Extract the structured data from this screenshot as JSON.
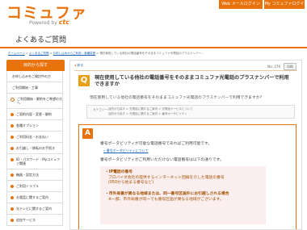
{
  "header": {
    "logo_text": "コミュファ",
    "logo_sub_prefix": "Powered by",
    "logo_sub_brand": "ctc",
    "top_nav": [
      "Web メールログイン",
      "My コミュファログイン"
    ],
    "page_title": "よくあるご質問"
  },
  "breadcrumb": {
    "items": [
      "ホームページ",
      "よくあるご質問",
      "お申し込みからご利用・各種変更",
      "現在使用している他社の電話番号をそのままコミュファ光電話のプラスナンバー..."
    ]
  },
  "sidebar": {
    "heading": "目的から探す",
    "items": [
      {
        "label": "お申し込みをご検討中の方",
        "style": "plain"
      },
      {
        "label": "ご利用開始・工事",
        "style": "plain"
      },
      {
        "label": "ご利用開始・解約をご希望の方へ",
        "style": "sub"
      },
      {
        "label": "ご契約内容・変更・解約",
        "style": "bullet"
      },
      {
        "label": "各種オプション",
        "style": "bullet"
      },
      {
        "label": "ご利用料金・お支払い",
        "style": "bullet"
      },
      {
        "label": "お引越し・移転のお手続き",
        "style": "bullet"
      },
      {
        "label": "ID・パスワード・Myコミュファ関連",
        "style": "bullet"
      },
      {
        "label": "機器・設定方法",
        "style": "bullet"
      },
      {
        "label": "ご利用トラブル",
        "style": "bullet"
      },
      {
        "label": "お電話に関するご案内",
        "style": "bullet"
      },
      {
        "label": "光テレビに関するご案内",
        "style": "bullet"
      },
      {
        "label": "追加サービス",
        "style": "bullet"
      }
    ]
  },
  "main": {
    "back_label": "戻る",
    "meta_label": "No: 276",
    "print_label": "印刷",
    "q_badge": "Q",
    "q_title": "現在使用している他社の電話番号をそのままコミュファ光電話のプラスナンバーで利用できますか",
    "q_body": "現在使用している他社の電話番号をそのままコミュファ光電話のプラスナンバーで利用できますか?",
    "category_label": "カテゴリー:",
    "category_line1": "目的から探す > 光電話に関するご案内 > 光電話サービスについて",
    "category_line2": "目的から探す > 光電話に関するご案内 > 番号ポータビリティ",
    "a_badge": "A",
    "answer_line1": "番号ポータビリティが可能な電話番号であればご利用可能です。",
    "answer_link": "» 番号ポータビリティについて",
    "answer_line2": "番号ポータビリティがご利用いただけない電話番号は以下の通りです。",
    "notes": [
      {
        "heading": "・IP電話の番号",
        "lines": [
          "プロバイダ会社の提供するインターネット回線を介した電話の番号",
          "(050から始まる番号など)"
        ]
      },
      {
        "heading": "・市外局番が異なる地域または、同一番号区画外にお引越しされる場合",
        "lines": [
          "※一部、市外局番が同一でも番号区画が異なる地域がございます。"
        ]
      }
    ]
  },
  "colors": {
    "brand_orange": "#e8720c",
    "q_badge": "#e8a012",
    "link": "#1a5fb4",
    "note_bg": "#fbeeee"
  }
}
